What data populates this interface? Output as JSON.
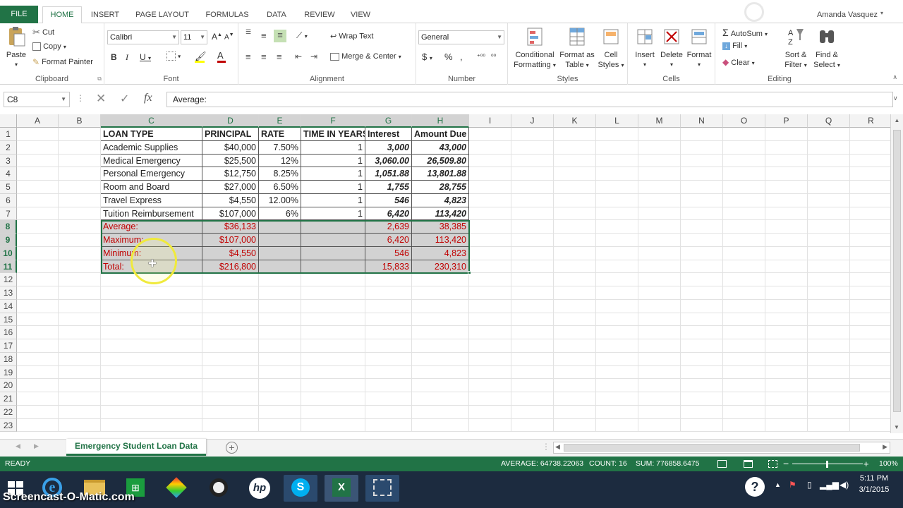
{
  "tabs": {
    "file": "FILE",
    "home": "HOME",
    "insert": "INSERT",
    "page_layout": "PAGE LAYOUT",
    "formulas": "FORMULAS",
    "data": "DATA",
    "review": "REVIEW",
    "view": "VIEW",
    "user": "Amanda Vasquez"
  },
  "clipboard": {
    "paste": "Paste",
    "cut": "Cut",
    "copy": "Copy",
    "format_painter": "Format Painter",
    "label": "Clipboard"
  },
  "font": {
    "name": "Calibri",
    "size": "11",
    "label": "Font"
  },
  "alignment": {
    "wrap": "Wrap Text",
    "merge": "Merge & Center",
    "label": "Alignment"
  },
  "number": {
    "format": "General",
    "label": "Number"
  },
  "styles": {
    "cond1": "Conditional",
    "cond2": "Formatting",
    "fmt1": "Format as",
    "fmt2": "Table",
    "cell1": "Cell",
    "cell2": "Styles",
    "label": "Styles"
  },
  "cells": {
    "insert": "Insert",
    "delete": "Delete",
    "format": "Format",
    "label": "Cells"
  },
  "editing": {
    "autosum": "AutoSum",
    "fill": "Fill",
    "clear": "Clear",
    "sort1": "Sort &",
    "sort2": "Filter",
    "find1": "Find &",
    "find2": "Select",
    "label": "Editing"
  },
  "formula_bar": {
    "name_box": "C8",
    "formula": "Average:"
  },
  "columns": [
    "A",
    "B",
    "C",
    "D",
    "E",
    "F",
    "G",
    "H",
    "I",
    "J",
    "K",
    "L",
    "M",
    "N",
    "O",
    "P",
    "Q",
    "R"
  ],
  "rows": [
    "1",
    "2",
    "3",
    "4",
    "5",
    "6",
    "7",
    "8",
    "9",
    "10",
    "11",
    "12",
    "13",
    "14",
    "15",
    "16",
    "17",
    "18",
    "19",
    "20",
    "21",
    "22",
    "23"
  ],
  "table": {
    "header": [
      "LOAN TYPE",
      "PRINCIPAL",
      "RATE",
      "TIME IN YEARS",
      "Interest",
      "Amount Due"
    ],
    "data": [
      [
        "Academic Supplies",
        "$40,000",
        "7.50%",
        "1",
        "3,000",
        "43,000"
      ],
      [
        "Medical Emergency",
        "$25,500",
        "12%",
        "1",
        "3,060.00",
        "26,509.80"
      ],
      [
        "Personal Emergency",
        "$12,750",
        "8.25%",
        "1",
        "1,051.88",
        "13,801.88"
      ],
      [
        "Room and Board",
        "$27,000",
        "6.50%",
        "1",
        "1,755",
        "28,755"
      ],
      [
        "Travel Express",
        "$4,550",
        "12.00%",
        "1",
        "546",
        "4,823"
      ],
      [
        "Tuition Reimbursement",
        "$107,000",
        "6%",
        "1",
        "6,420",
        "113,420"
      ]
    ],
    "summary": [
      [
        "Average:",
        "$36,133",
        "",
        "",
        "2,639",
        "38,385"
      ],
      [
        "Maximum:",
        "$107,000",
        "",
        "",
        "6,420",
        "113,420"
      ],
      [
        "Minimum:",
        "$4,550",
        "",
        "",
        "546",
        "4,823"
      ],
      [
        "Total:",
        "$216,800",
        "",
        "",
        "15,833",
        "230,310"
      ]
    ]
  },
  "sheet_tab": "Emergency Student Loan Data",
  "status": {
    "ready": "READY",
    "average": "AVERAGE: 64738.22063",
    "count": "COUNT: 16",
    "sum": "SUM: 776858.6475",
    "zoom": "100%"
  },
  "taskbar": {
    "time": "5:11 PM",
    "date": "3/1/2015",
    "watermark": "Screencast-O-Matic.com"
  },
  "colors": {
    "accent": "#217346",
    "red_text": "#c00000",
    "selection": "#d2d2d2"
  }
}
